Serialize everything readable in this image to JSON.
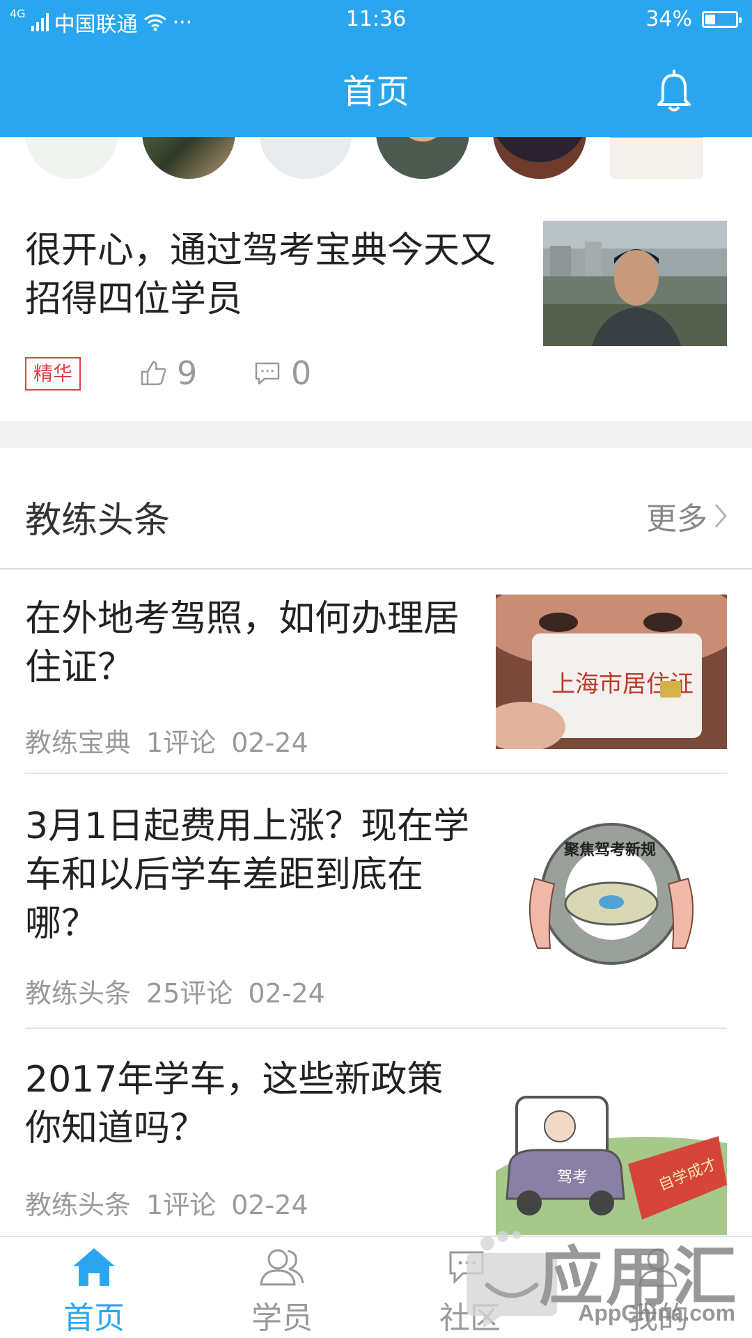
{
  "status_bar": {
    "network": "4G",
    "carrier": "中国联通",
    "dots": "···",
    "time": "11:36",
    "battery": "34%",
    "battery_level": 0.34
  },
  "header": {
    "title": "首页"
  },
  "featured_post": {
    "title": "很开心，通过驾考宝典今天又招得四位学员",
    "tag": "精华",
    "likes": "9",
    "comments": "0"
  },
  "section": {
    "title": "教练头条",
    "more": "更多"
  },
  "articles": [
    {
      "title": "在外地考驾照，如何办理居住证？",
      "source": "教练宝典",
      "comments": "1评论",
      "date": "02-24",
      "thumb_text": "上海市居住证"
    },
    {
      "title": "3月1日起费用上涨？现在学车和以后学车差距到底在哪？",
      "source": "教练头条",
      "comments": "25评论",
      "date": "02-24",
      "thumb_text": "聚焦驾考新规"
    },
    {
      "title": "2017年学车，这些新政策你知道吗？",
      "source": "教练头条",
      "comments": "1评论",
      "date": "02-24",
      "thumb_text_1": "驾考",
      "thumb_text_2": "自学成才"
    }
  ],
  "tabs": [
    {
      "label": "首页",
      "icon": "home-icon",
      "active": true
    },
    {
      "label": "学员",
      "icon": "students-icon",
      "active": false
    },
    {
      "label": "社区",
      "icon": "community-icon",
      "active": false
    },
    {
      "label": "我的",
      "icon": "profile-icon",
      "active": false
    }
  ],
  "watermark": {
    "text": "应用汇",
    "sub": "AppChina.com"
  },
  "colors": {
    "accent": "#2aa6ee",
    "tag_red": "#e04040",
    "muted": "#9a9a9a"
  }
}
